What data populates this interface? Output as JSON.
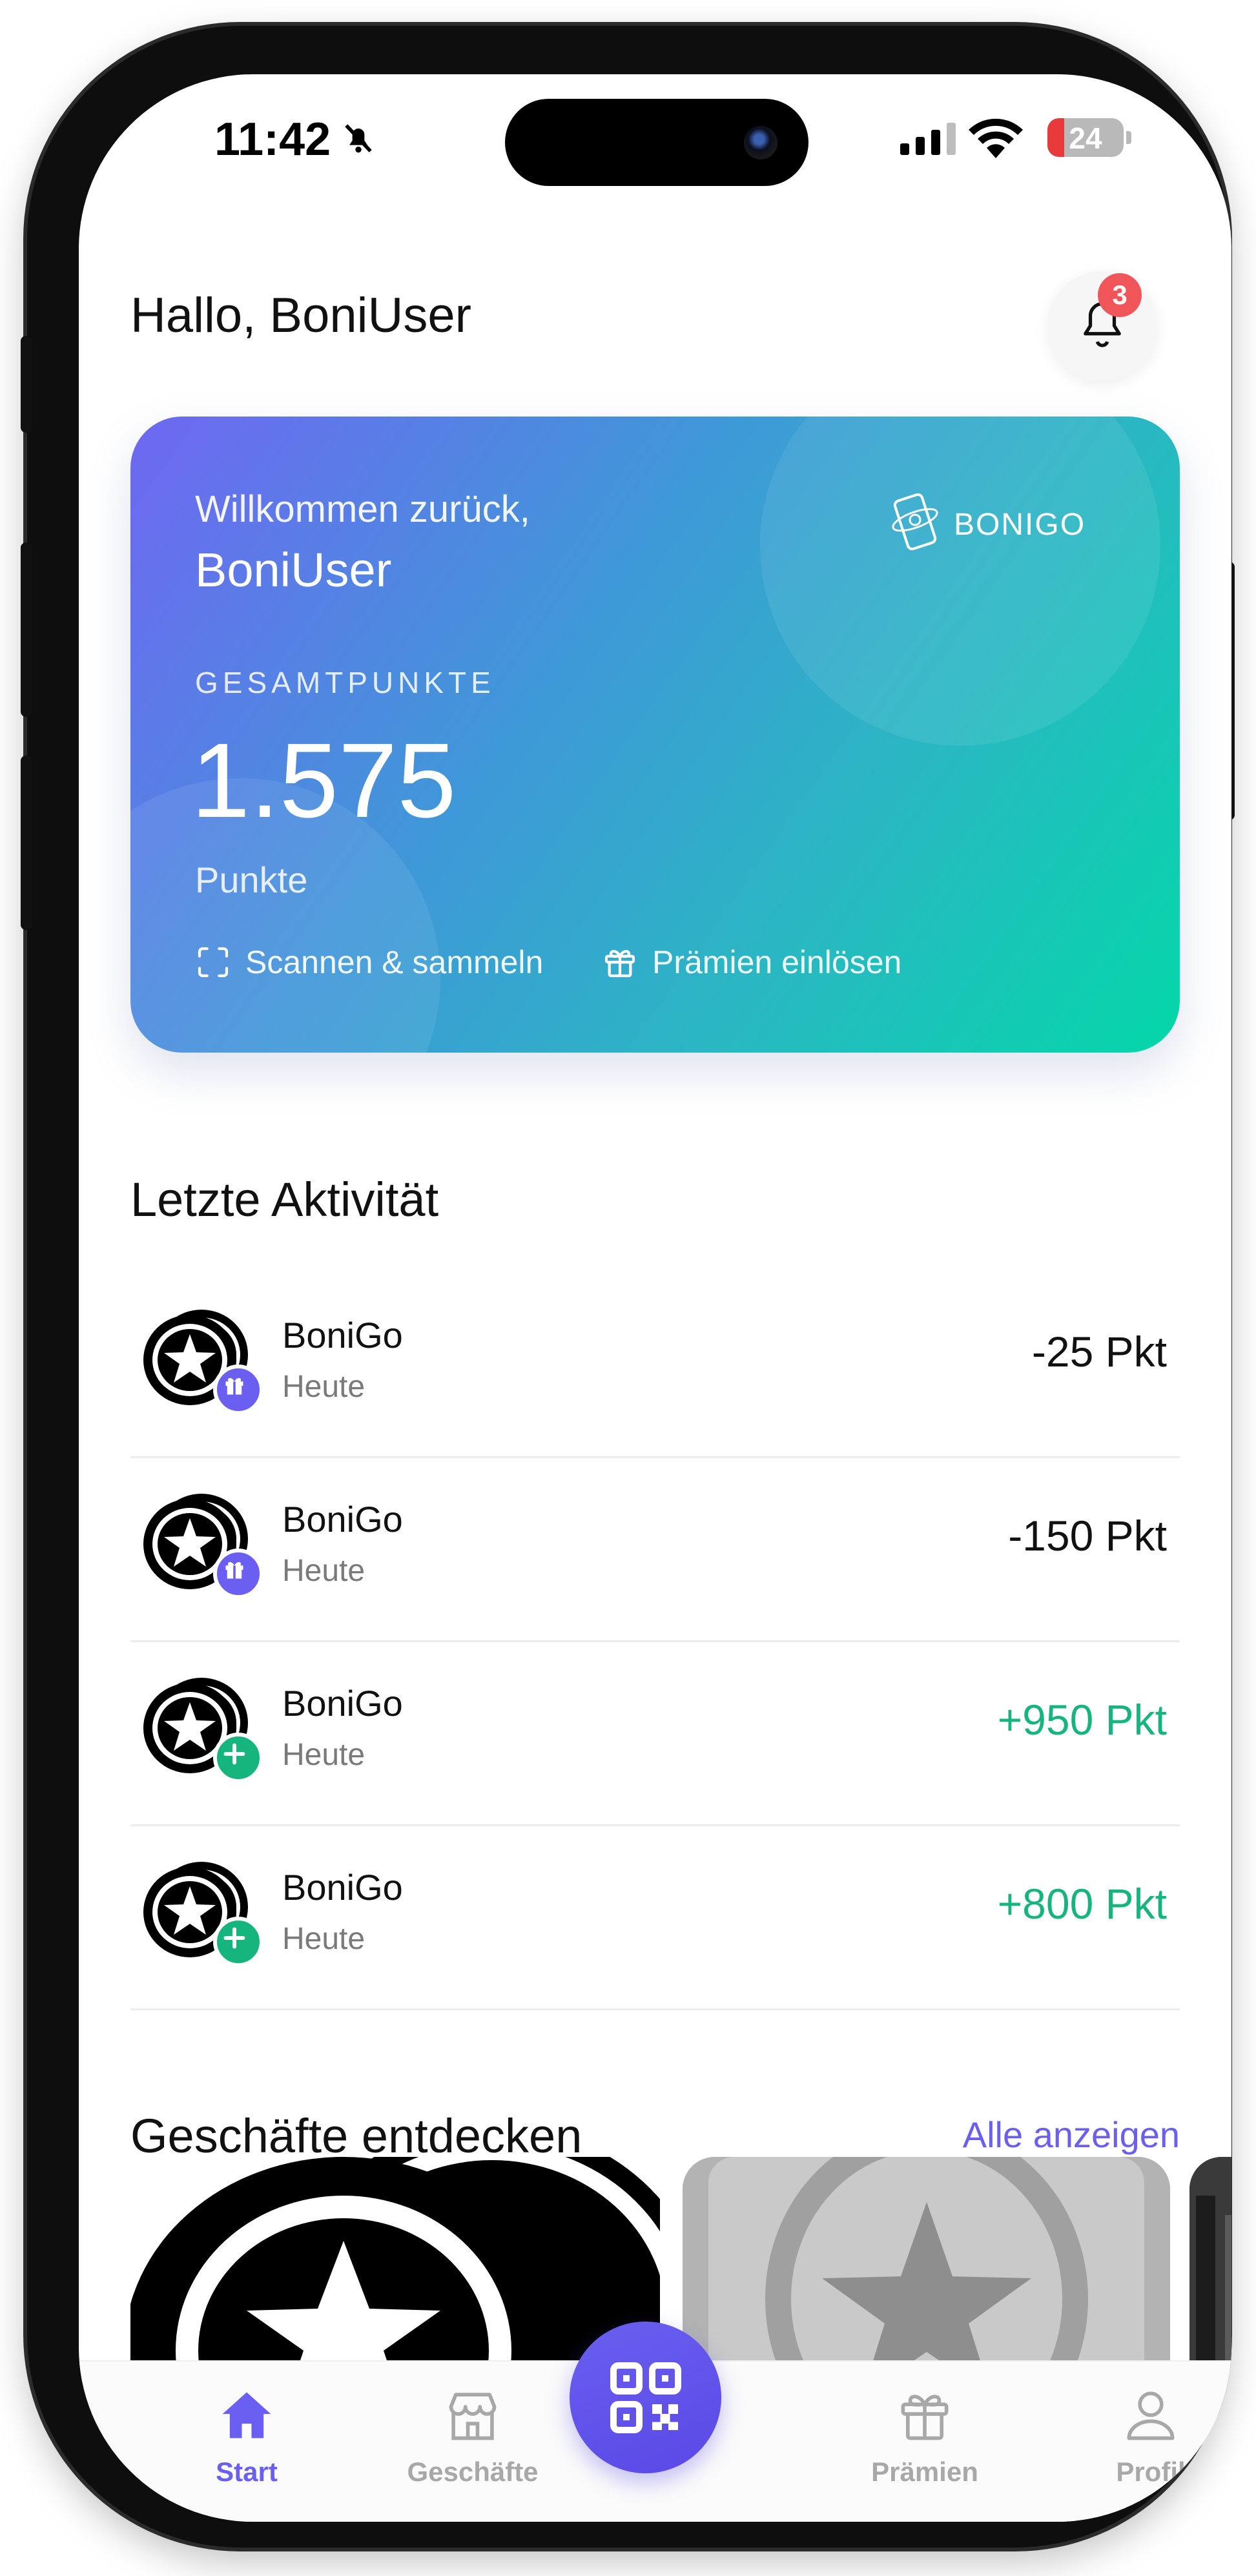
{
  "status_bar": {
    "time": "11:42",
    "battery": "24"
  },
  "header": {
    "greeting": "Hallo, BoniUser",
    "notification_count": "3"
  },
  "card": {
    "welcome": "Willkommen zurück,",
    "username": "BoniUser",
    "brand": "BONIGO",
    "total_label": "GESAMTPUNKTE",
    "total": "1.575",
    "unit": "Punkte",
    "scan_label": "Scannen & sammeln",
    "redeem_label": "Prämien einlösen"
  },
  "activity": {
    "title": "Letzte Aktivität",
    "items": [
      {
        "name": "BoniGo",
        "date": "Heute",
        "points": "-25 Pkt",
        "type": "redeem"
      },
      {
        "name": "BoniGo",
        "date": "Heute",
        "points": "-150 Pkt",
        "type": "redeem"
      },
      {
        "name": "BoniGo",
        "date": "Heute",
        "points": "+950 Pkt",
        "type": "earn"
      },
      {
        "name": "BoniGo",
        "date": "Heute",
        "points": "+800 Pkt",
        "type": "earn"
      }
    ]
  },
  "shops": {
    "title": "Geschäfte entdecken",
    "see_all": "Alle anzeigen"
  },
  "tabbar": {
    "start": "Start",
    "shops": "Geschäfte",
    "rewards": "Prämien",
    "profile": "Profil"
  },
  "colors": {
    "accent": "#6a5ff0",
    "positive": "#16b57e",
    "badge": "#f0555a"
  }
}
